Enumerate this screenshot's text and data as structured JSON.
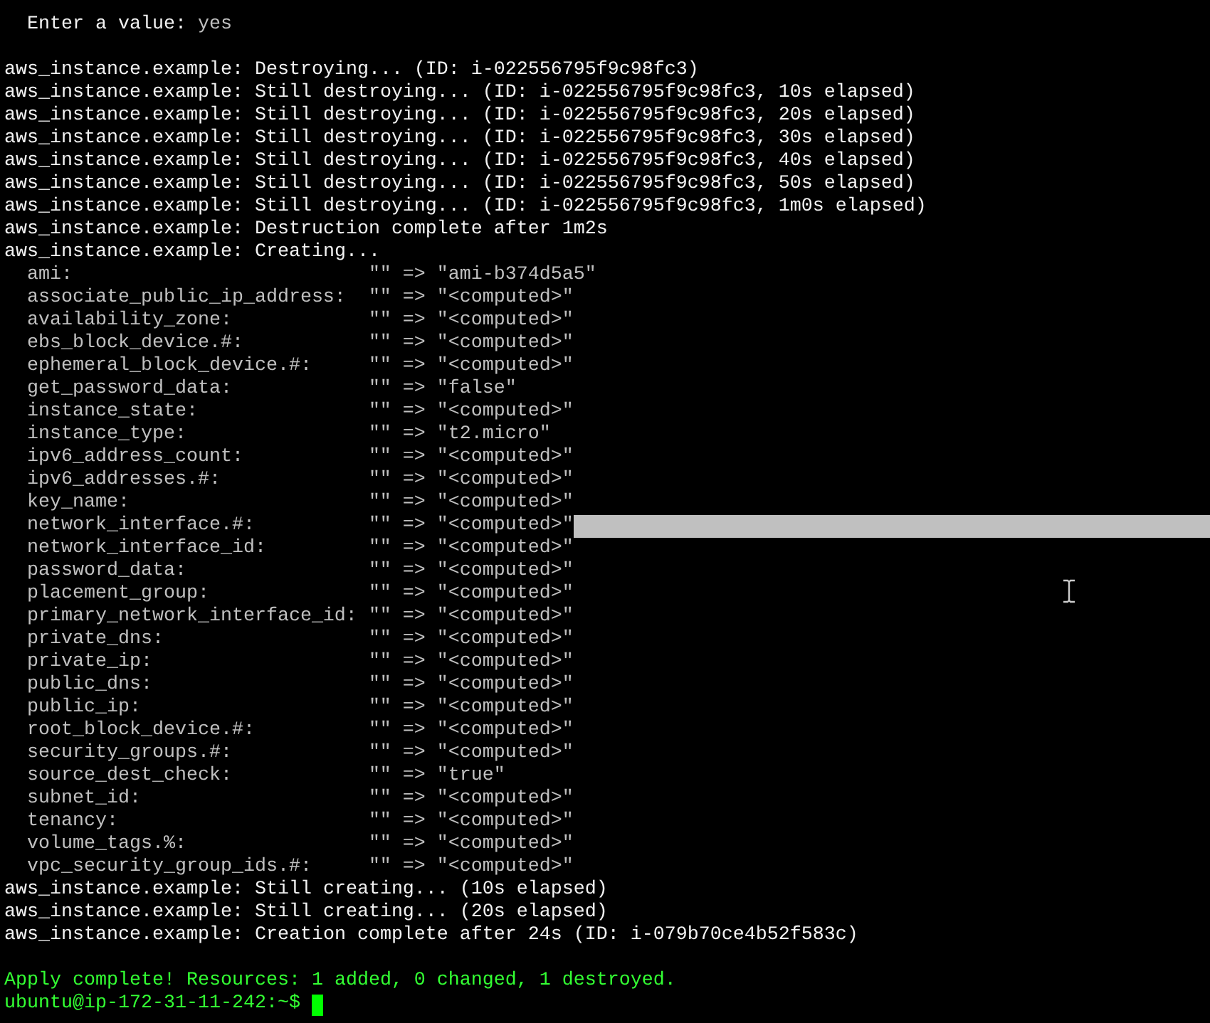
{
  "terminal": {
    "lines": [
      {
        "kind": "prompt",
        "text": "  Enter a value:",
        "value": "yes"
      },
      {
        "kind": "blank"
      },
      {
        "kind": "output",
        "text": "aws_instance.example: Destroying... (ID: i-022556795f9c98fc3)"
      },
      {
        "kind": "output",
        "text": "aws_instance.example: Still destroying... (ID: i-022556795f9c98fc3, 10s elapsed)"
      },
      {
        "kind": "output",
        "text": "aws_instance.example: Still destroying... (ID: i-022556795f9c98fc3, 20s elapsed)"
      },
      {
        "kind": "output",
        "text": "aws_instance.example: Still destroying... (ID: i-022556795f9c98fc3, 30s elapsed)"
      },
      {
        "kind": "output",
        "text": "aws_instance.example: Still destroying... (ID: i-022556795f9c98fc3, 40s elapsed)"
      },
      {
        "kind": "output",
        "text": "aws_instance.example: Still destroying... (ID: i-022556795f9c98fc3, 50s elapsed)"
      },
      {
        "kind": "output",
        "text": "aws_instance.example: Still destroying... (ID: i-022556795f9c98fc3, 1m0s elapsed)"
      },
      {
        "kind": "output",
        "text": "aws_instance.example: Destruction complete after 1m2s"
      },
      {
        "kind": "output",
        "text": "aws_instance.example: Creating..."
      },
      {
        "kind": "attr",
        "name": "ami:",
        "value": "\"\" => \"ami-b374d5a5\"",
        "selected": false
      },
      {
        "kind": "attr",
        "name": "associate_public_ip_address:",
        "value": "\"\" => \"<computed>\"",
        "selected": false
      },
      {
        "kind": "attr",
        "name": "availability_zone:",
        "value": "\"\" => \"<computed>\"",
        "selected": false
      },
      {
        "kind": "attr",
        "name": "ebs_block_device.#:",
        "value": "\"\" => \"<computed>\"",
        "selected": false
      },
      {
        "kind": "attr",
        "name": "ephemeral_block_device.#:",
        "value": "\"\" => \"<computed>\"",
        "selected": false
      },
      {
        "kind": "attr",
        "name": "get_password_data:",
        "value": "\"\" => \"false\"",
        "selected": false
      },
      {
        "kind": "attr",
        "name": "instance_state:",
        "value": "\"\" => \"<computed>\"",
        "selected": false
      },
      {
        "kind": "attr",
        "name": "instance_type:",
        "value": "\"\" => \"t2.micro\"",
        "selected": false
      },
      {
        "kind": "attr",
        "name": "ipv6_address_count:",
        "value": "\"\" => \"<computed>\"",
        "selected": false
      },
      {
        "kind": "attr",
        "name": "ipv6_addresses.#:",
        "value": "\"\" => \"<computed>\"",
        "selected": false
      },
      {
        "kind": "attr",
        "name": "key_name:",
        "value": "\"\" => \"<computed>\"",
        "selected": false
      },
      {
        "kind": "attr",
        "name": "network_interface.#:",
        "value": "\"\" => \"<computed>\"",
        "selected": true
      },
      {
        "kind": "attr",
        "name": "network_interface_id:",
        "value": "\"\" => \"<computed>\"",
        "selected": false
      },
      {
        "kind": "attr",
        "name": "password_data:",
        "value": "\"\" => \"<computed>\"",
        "selected": false
      },
      {
        "kind": "attr",
        "name": "placement_group:",
        "value": "\"\" => \"<computed>\"",
        "selected": false
      },
      {
        "kind": "attr",
        "name": "primary_network_interface_id:",
        "value": "\"\" => \"<computed>\"",
        "selected": false
      },
      {
        "kind": "attr",
        "name": "private_dns:",
        "value": "\"\" => \"<computed>\"",
        "selected": false
      },
      {
        "kind": "attr",
        "name": "private_ip:",
        "value": "\"\" => \"<computed>\"",
        "selected": false
      },
      {
        "kind": "attr",
        "name": "public_dns:",
        "value": "\"\" => \"<computed>\"",
        "selected": false
      },
      {
        "kind": "attr",
        "name": "public_ip:",
        "value": "\"\" => \"<computed>\"",
        "selected": false
      },
      {
        "kind": "attr",
        "name": "root_block_device.#:",
        "value": "\"\" => \"<computed>\"",
        "selected": false
      },
      {
        "kind": "attr",
        "name": "security_groups.#:",
        "value": "\"\" => \"<computed>\"",
        "selected": false
      },
      {
        "kind": "attr",
        "name": "source_dest_check:",
        "value": "\"\" => \"true\"",
        "selected": false
      },
      {
        "kind": "attr",
        "name": "subnet_id:",
        "value": "\"\" => \"<computed>\"",
        "selected": false
      },
      {
        "kind": "attr",
        "name": "tenancy:",
        "value": "\"\" => \"<computed>\"",
        "selected": false
      },
      {
        "kind": "attr",
        "name": "volume_tags.%:",
        "value": "\"\" => \"<computed>\"",
        "selected": false
      },
      {
        "kind": "attr",
        "name": "vpc_security_group_ids.#:",
        "value": "\"\" => \"<computed>\"",
        "selected": false
      },
      {
        "kind": "output",
        "text": "aws_instance.example: Still creating... (10s elapsed)"
      },
      {
        "kind": "output",
        "text": "aws_instance.example: Still creating... (20s elapsed)"
      },
      {
        "kind": "output",
        "text": "aws_instance.example: Creation complete after 24s (ID: i-079b70ce4b52f583c)"
      },
      {
        "kind": "blank"
      },
      {
        "kind": "success",
        "text": "Apply complete! Resources: 1 added, 0 changed, 1 destroyed."
      },
      {
        "kind": "shell",
        "text": "ubuntu@ip-172-31-11-242:~$"
      }
    ]
  }
}
